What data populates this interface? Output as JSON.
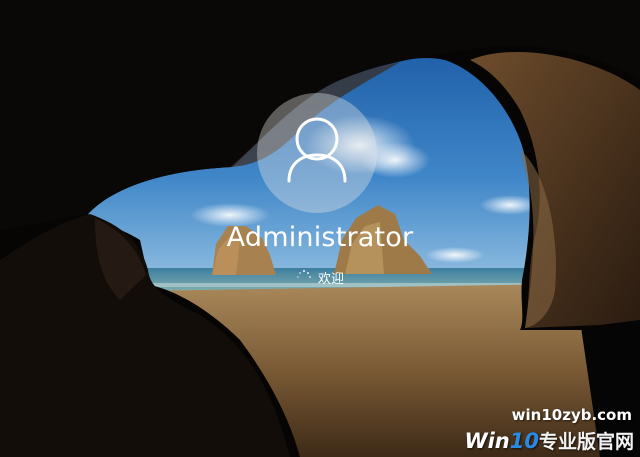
{
  "lock_screen": {
    "user_name": "Administrator",
    "status_text": "欢迎",
    "avatar_icon": "user-icon",
    "spinner_icon": "loading-spinner-icon"
  },
  "watermark": {
    "url": "win10zyb.com",
    "brand_win": "Win",
    "brand_num": "10",
    "brand_cn": "专业版官网"
  },
  "colors": {
    "text": "#ffffff",
    "avatar_bg": "#e6e6e6",
    "brand_accent": "#2a8be3"
  }
}
